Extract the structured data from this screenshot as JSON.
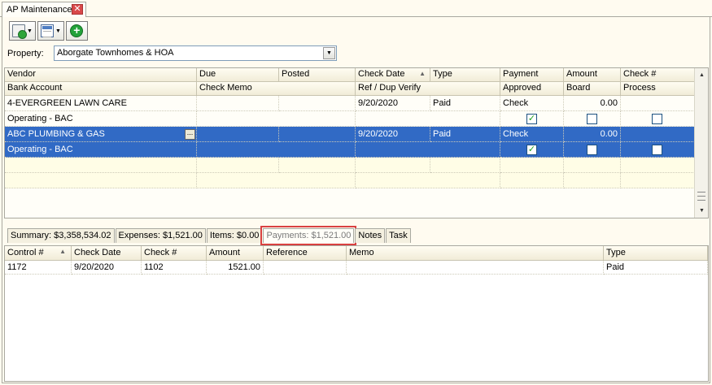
{
  "window": {
    "tab_title": "AP Maintenance",
    "close_glyph": "✕"
  },
  "toolbar": {
    "buttons": [
      {
        "icon": "new-document-icon",
        "has_dropdown": true
      },
      {
        "icon": "grid-layout-icon",
        "has_dropdown": true
      },
      {
        "icon": "add-icon",
        "has_dropdown": false
      }
    ]
  },
  "property": {
    "label": "Property:",
    "value": "Aborgate Townhomes & HOA"
  },
  "grid": {
    "headers_row1": [
      "Vendor",
      "Due",
      "Posted",
      "Check Date",
      "Type",
      "Payment",
      "Amount",
      "Check #"
    ],
    "headers_row2": [
      "Bank Account",
      "Check Memo",
      "",
      "Ref / Dup Verify",
      "",
      "Approved",
      "Board",
      "Process"
    ],
    "check_date_sort_glyph": "▲",
    "rows": [
      {
        "vendor": "4-EVERGREEN LAWN CARE",
        "due": "",
        "posted": "",
        "check_date": "9/20/2020",
        "type": "Paid",
        "payment": "Check",
        "amount": "0.00",
        "check_no": "",
        "bank_account": "Operating - BAC",
        "approved": true,
        "board": false,
        "process": false,
        "selected": false
      },
      {
        "vendor": "ABC PLUMBING & GAS",
        "due": "",
        "posted": "",
        "check_date": "9/20/2020",
        "type": "Paid",
        "payment": "Check",
        "amount": "0.00",
        "check_no": "",
        "bank_account": "Operating - BAC",
        "approved": true,
        "board": false,
        "process": false,
        "selected": true
      }
    ],
    "ellipsis_label": "..."
  },
  "bottom_tabs": [
    {
      "label": "Summary: $3,358,534.02",
      "active": false
    },
    {
      "label": "Expenses: $1,521.00",
      "active": false
    },
    {
      "label": "Items: $0.00",
      "active": false
    },
    {
      "label": "Payments: $1,521.00",
      "active": true
    },
    {
      "label": "Notes",
      "active": false
    },
    {
      "label": "Task",
      "active": false
    }
  ],
  "payments": {
    "headers": [
      "Control #",
      "Check Date",
      "Check #",
      "Amount",
      "Reference",
      "Memo",
      "Type"
    ],
    "control_sort_glyph": "▲",
    "rows": [
      {
        "control": "1172",
        "check_date": "9/20/2020",
        "check_no": "1102",
        "amount": "1521.00",
        "reference": "",
        "memo": "",
        "type": "Paid"
      }
    ]
  },
  "colors": {
    "selection": "#316ac5",
    "highlight_outline": "#d94141",
    "background": "#fffbf0"
  }
}
